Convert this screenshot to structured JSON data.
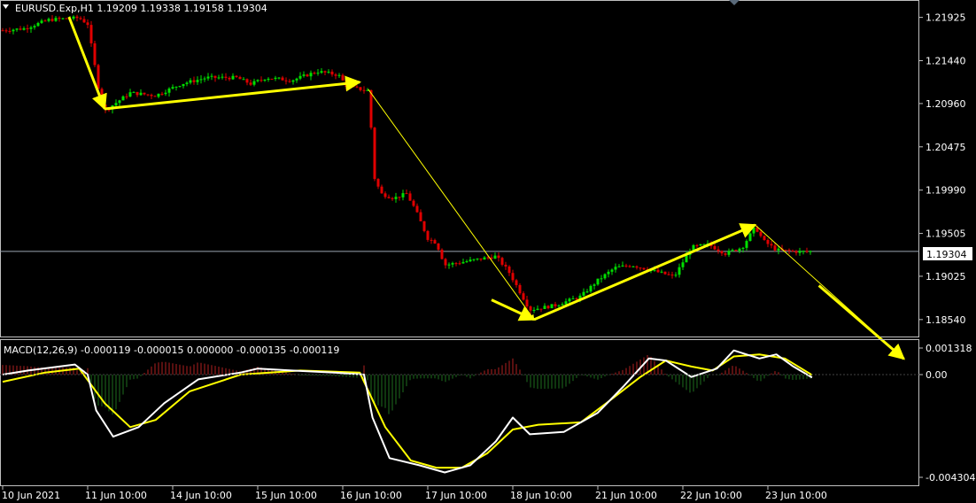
{
  "header": {
    "symbol_label": "EURUSD.Exp,H1",
    "ohlc": [
      "1.19209",
      "1.19338",
      "1.19158",
      "1.19304"
    ],
    "text": "EURUSD.Exp,H1  1.19209 1.19338 1.19158 1.19304"
  },
  "current_price_label": "1.19304",
  "macd_header": "MACD(12,26,9) -0.000119 -0.000015 0.000000 -0.000135 -0.000119",
  "price_axis_labels": [
    "1.21925",
    "1.21440",
    "1.20960",
    "1.20475",
    "1.19990",
    "1.19505",
    "1.19025",
    "1.18540"
  ],
  "macd_axis_labels": [
    "0.001318",
    "0.00",
    "-0.004304"
  ],
  "time_labels": [
    "10 Jun 2021",
    "11 Jun 10:00",
    "14 Jun 10:00",
    "15 Jun 10:00",
    "16 Jun 10:00",
    "17 Jun 10:00",
    "18 Jun 10:00",
    "21 Jun 10:00",
    "22 Jun 10:00",
    "23 Jun 10:00"
  ],
  "colors": {
    "background": "#000000",
    "bull": "#00e000",
    "bear": "#e00000",
    "arrow": "#ffff00",
    "macd_line": "#ffffff",
    "signal_line": "#ffff00",
    "hist_pos": "#b02020",
    "hist_neg": "#1e6e1e",
    "axis": "#c0c0c0",
    "price_line": "#9aa4b0"
  },
  "chart_data": [
    {
      "type": "candlestick",
      "title": "EURUSD.Exp,H1",
      "ylim": [
        1.1835,
        1.221
      ],
      "current_price": 1.19304,
      "x_categories": [
        "10 Jun 2021",
        "11 Jun 10:00",
        "14 Jun 10:00",
        "15 Jun 10:00",
        "16 Jun 10:00",
        "17 Jun 10:00",
        "18 Jun 10:00",
        "21 Jun 10:00",
        "22 Jun 10:00",
        "23 Jun 10:00"
      ],
      "price_path": [
        [
          0,
          1.2178
        ],
        [
          0.25,
          1.218
        ],
        [
          0.55,
          1.219
        ],
        [
          0.9,
          1.2192
        ],
        [
          1.0,
          1.2185
        ],
        [
          1.08,
          1.214
        ],
        [
          1.15,
          1.21
        ],
        [
          1.2,
          1.2088
        ],
        [
          1.5,
          1.2108
        ],
        [
          1.8,
          1.2105
        ],
        [
          2.1,
          1.2118
        ],
        [
          2.4,
          1.2125
        ],
        [
          2.75,
          1.2125
        ],
        [
          2.92,
          1.2118
        ],
        [
          3.1,
          1.2125
        ],
        [
          3.4,
          1.2122
        ],
        [
          3.7,
          1.2132
        ],
        [
          3.95,
          1.2128
        ],
        [
          4.05,
          1.2115
        ],
        [
          4.32,
          1.211
        ],
        [
          4.35,
          1.2018
        ],
        [
          4.45,
          1.1995
        ],
        [
          4.6,
          1.199
        ],
        [
          4.75,
          1.1995
        ],
        [
          4.85,
          1.1978
        ],
        [
          5.0,
          1.1945
        ],
        [
          5.1,
          1.194
        ],
        [
          5.2,
          1.1915
        ],
        [
          5.5,
          1.192
        ],
        [
          5.8,
          1.1925
        ],
        [
          5.95,
          1.1908
        ],
        [
          6.2,
          1.1865
        ],
        [
          6.5,
          1.187
        ],
        [
          6.8,
          1.188
        ],
        [
          7.0,
          1.1898
        ],
        [
          7.2,
          1.1912
        ],
        [
          7.4,
          1.1915
        ],
        [
          7.6,
          1.191
        ],
        [
          7.9,
          1.1902
        ],
        [
          8.1,
          1.1935
        ],
        [
          8.3,
          1.1938
        ],
        [
          8.5,
          1.1928
        ],
        [
          8.7,
          1.1935
        ],
        [
          8.85,
          1.1958
        ],
        [
          8.95,
          1.1942
        ],
        [
          9.1,
          1.1932
        ],
        [
          9.35,
          1.193
        ],
        [
          9.52,
          1.19304
        ]
      ],
      "arrows": [
        {
          "from": [
            0.78,
            1.2193
          ],
          "to": [
            1.2,
            1.209
          ]
        },
        {
          "from": [
            1.2,
            1.209
          ],
          "to": [
            4.2,
            1.212
          ]
        },
        {
          "from": [
            4.3,
            1.2112
          ],
          "to": [
            6.25,
            1.1854
          ]
        },
        {
          "from": [
            6.25,
            1.1854
          ],
          "to": [
            8.85,
            1.196
          ]
        },
        {
          "from": [
            8.85,
            1.196
          ],
          "to": [
            10.6,
            1.181
          ]
        }
      ]
    },
    {
      "type": "macd",
      "title": "MACD(12,26,9)",
      "parameters": [
        12,
        26,
        9
      ],
      "values": [
        -0.000119,
        -1.5e-05,
        0.0,
        -0.000135,
        -0.000119
      ],
      "ylim": [
        -0.004304,
        0.001318
      ],
      "macd_line": [
        [
          0,
          0.0
        ],
        [
          0.3,
          0.0002
        ],
        [
          0.85,
          0.0005
        ],
        [
          1.0,
          0.0
        ],
        [
          1.1,
          -0.0015
        ],
        [
          1.3,
          -0.0026
        ],
        [
          1.6,
          -0.0022
        ],
        [
          1.9,
          -0.0012
        ],
        [
          2.3,
          -0.0002
        ],
        [
          2.8,
          0.0001
        ],
        [
          3.0,
          0.0003
        ],
        [
          3.4,
          0.0002
        ],
        [
          3.9,
          0.0001
        ],
        [
          4.25,
          0.0
        ],
        [
          4.35,
          -0.0018
        ],
        [
          4.55,
          -0.0035
        ],
        [
          4.9,
          -0.0038
        ],
        [
          5.2,
          -0.0041
        ],
        [
          5.5,
          -0.0038
        ],
        [
          5.8,
          -0.0028
        ],
        [
          6.0,
          -0.0018
        ],
        [
          6.2,
          -0.0025
        ],
        [
          6.6,
          -0.0024
        ],
        [
          7.0,
          -0.0016
        ],
        [
          7.3,
          -0.0005
        ],
        [
          7.6,
          0.0008
        ],
        [
          7.8,
          0.0007
        ],
        [
          8.1,
          -0.0001
        ],
        [
          8.4,
          0.0003
        ],
        [
          8.6,
          0.0012
        ],
        [
          8.9,
          0.0008
        ],
        [
          9.1,
          0.001
        ],
        [
          9.3,
          0.0004
        ],
        [
          9.52,
          -0.00012
        ]
      ],
      "signal_line": [
        [
          0,
          -0.0003
        ],
        [
          0.5,
          0.0001
        ],
        [
          0.9,
          0.0003
        ],
        [
          1.2,
          -0.0012
        ],
        [
          1.5,
          -0.0022
        ],
        [
          1.8,
          -0.0019
        ],
        [
          2.2,
          -0.0007
        ],
        [
          2.8,
          0.0
        ],
        [
          3.5,
          0.0002
        ],
        [
          4.2,
          0.0001
        ],
        [
          4.5,
          -0.0022
        ],
        [
          4.8,
          -0.0036
        ],
        [
          5.1,
          -0.0039
        ],
        [
          5.4,
          -0.0039
        ],
        [
          5.7,
          -0.0033
        ],
        [
          6.0,
          -0.0023
        ],
        [
          6.3,
          -0.0021
        ],
        [
          6.8,
          -0.002
        ],
        [
          7.1,
          -0.0012
        ],
        [
          7.5,
          -0.0001
        ],
        [
          7.8,
          0.0007
        ],
        [
          8.1,
          0.0004
        ],
        [
          8.35,
          0.0002
        ],
        [
          8.6,
          0.0009
        ],
        [
          8.9,
          0.001
        ],
        [
          9.2,
          0.0008
        ],
        [
          9.52,
          -2e-05
        ]
      ]
    }
  ]
}
